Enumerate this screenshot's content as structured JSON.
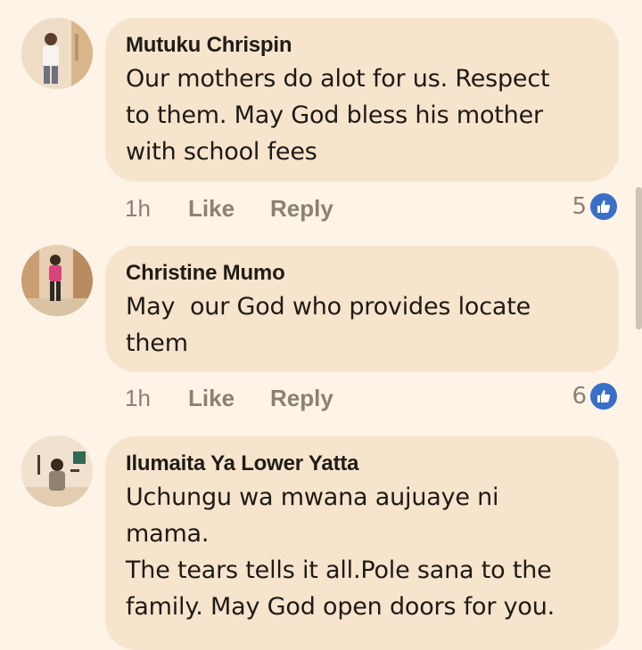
{
  "comments": [
    {
      "author": "Mutuku Chrispin",
      "text": "Our mothers do alot for us. Respect\nto them. May God bless his mother\nwith school fees",
      "time": "1h",
      "like_label": "Like",
      "reply_label": "Reply",
      "reaction_count": "5"
    },
    {
      "author": "Christine Mumo",
      "text": "May  our God who provides locate\nthem",
      "time": "1h",
      "like_label": "Like",
      "reply_label": "Reply",
      "reaction_count": "6"
    },
    {
      "author": "Ilumaita Ya Lower Yatta",
      "text": "Uchungu wa mwana aujuaye ni\nmama.\nThe tears tells it all.Pole sana to the\nfamily. May God open doors for you."
    }
  ],
  "colors": {
    "page_background": "#fdf3e6",
    "bubble_background": "#f7e4cc",
    "like_icon_blue": "#3a6fc8",
    "meta_text": "#8a8074"
  },
  "icons": [
    "avatar-photo",
    "thumbs-up-icon"
  ]
}
